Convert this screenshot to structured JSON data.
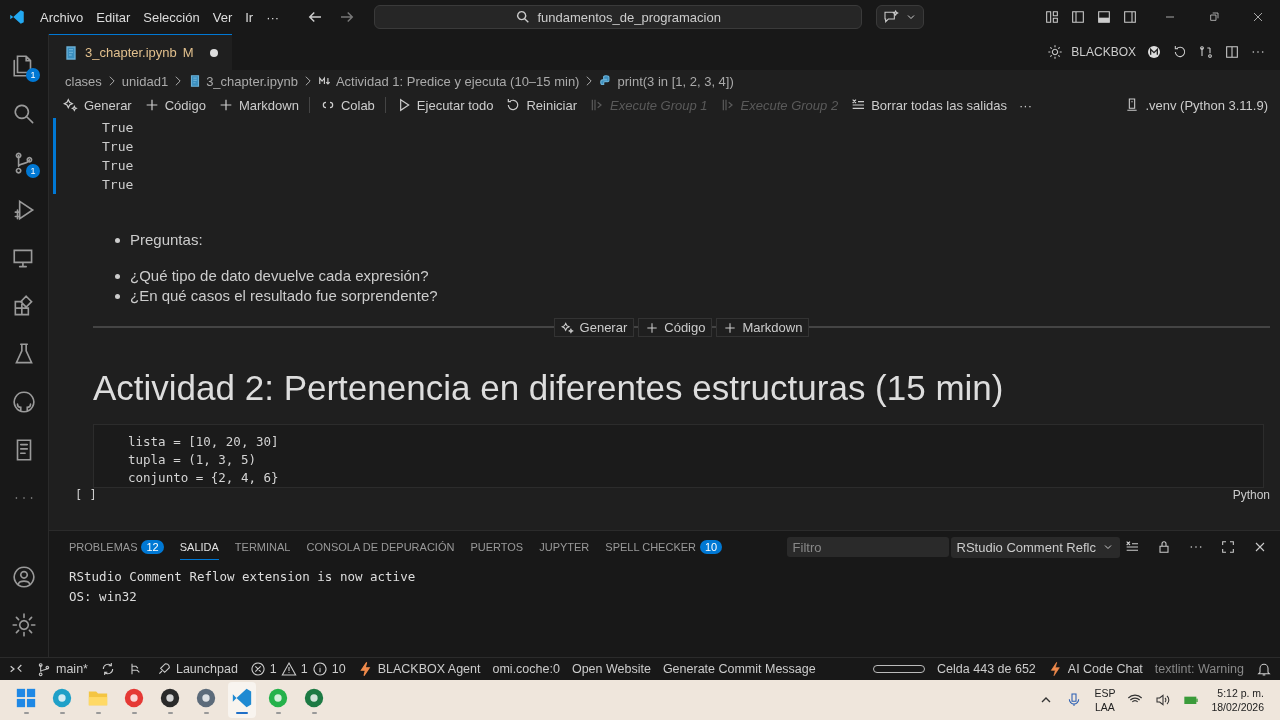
{
  "title_bar": {
    "menu": [
      "Archivo",
      "Editar",
      "Selección",
      "Ver",
      "Ir",
      "···"
    ],
    "search": "fundamentos_de_programacion"
  },
  "activity_bar": [
    {
      "kind": "files",
      "badge": "1"
    },
    {
      "kind": "search"
    },
    {
      "kind": "branch",
      "badge": "1"
    },
    {
      "kind": "debug"
    },
    {
      "kind": "remote"
    },
    {
      "kind": "extensions"
    },
    {
      "kind": "flask"
    },
    {
      "kind": "github"
    },
    {
      "kind": "notebook"
    },
    {
      "kind": "more"
    }
  ],
  "activity_bottom": [
    {
      "kind": "account"
    },
    {
      "kind": "settings"
    }
  ],
  "tabs": [
    {
      "label": "3_chapter.ipynb",
      "status": "M",
      "modified": true,
      "selected": true
    }
  ],
  "editor_actions": {
    "label": "BLACKBOX"
  },
  "breadcrumb": [
    {
      "kind": "folder",
      "label": "clases"
    },
    {
      "kind": "folder",
      "label": "unidad1"
    },
    {
      "kind": "notebook",
      "label": "3_chapter.ipynb"
    },
    {
      "kind": "markdown",
      "label": "Actividad 1: Predice y ejecuta (10–15 min)"
    },
    {
      "kind": "python",
      "label": "print(3 in [1, 2, 3, 4])"
    }
  ],
  "toolbar": [
    {
      "kind": "sparkle",
      "label": "Generar",
      "disabled": false
    },
    {
      "kind": "plus",
      "label": "Código",
      "disabled": false
    },
    {
      "kind": "plus",
      "label": "Markdown",
      "disabled": false
    },
    {
      "kind": "colab",
      "label": "Colab",
      "disabled": false
    },
    {
      "kind": "run",
      "label": "Ejecutar todo",
      "disabled": false
    },
    {
      "kind": "restart",
      "label": "Reiniciar",
      "disabled": false
    },
    {
      "kind": "group",
      "label": "Execute Group 1",
      "disabled": true
    },
    {
      "kind": "group",
      "label": "Execute Group 2",
      "disabled": true
    },
    {
      "kind": "clear",
      "label": "Borrar todas las salidas",
      "disabled": false
    },
    {
      "kind": "more",
      "label": "···",
      "disabled": false
    }
  ],
  "kernel": ".venv (Python 3.11.9)",
  "output_lines": [
    "True",
    "True",
    "True",
    "True"
  ],
  "markdown": {
    "lead": "Preguntas:",
    "questions": [
      "¿Qué tipo de dato devuelve cada expresión?",
      "¿En qué casos el resultado fue sorprendente?"
    ]
  },
  "insert_bar": [
    {
      "kind": "sparkle",
      "label": "Generar"
    },
    {
      "kind": "plus",
      "label": "Código"
    },
    {
      "kind": "plus",
      "label": "Markdown"
    }
  ],
  "heading": "Actividad 2: Pertenencia en diferentes estructuras (15 min)",
  "code_cell": {
    "exec": "[ ]",
    "language": "Python",
    "lines": [
      "lista = [10, 20, 30]",
      "tupla = (1, 3, 5)",
      "conjunto = {2, 4, 6}"
    ]
  },
  "panel": {
    "tabs": [
      {
        "label": "PROBLEMAS",
        "badge": "12",
        "selected": false
      },
      {
        "label": "SALIDA",
        "selected": true
      },
      {
        "label": "TERMINAL",
        "selected": false
      },
      {
        "label": "CONSOLA DE DEPURACIÓN",
        "selected": false
      },
      {
        "label": "PUERTOS",
        "selected": false
      },
      {
        "label": "JUPYTER",
        "selected": false
      },
      {
        "label": "SPELL CHECKER",
        "badge": "10",
        "selected": false
      }
    ],
    "filter_placeholder": "Filtro",
    "channel": "RStudio Comment Reflc",
    "output": [
      "RStudio Comment Reflow extension is now active",
      "OS: win32"
    ]
  },
  "status_bar": {
    "left": [
      {
        "kind": "branch",
        "label": "main*"
      },
      {
        "kind": "graph"
      },
      {
        "kind": "launchpad",
        "label": "Launchpad"
      },
      {
        "kind": "problems",
        "errors": "1",
        "warnings": "1",
        "infos": "10"
      },
      {
        "kind": "bolt",
        "label": "BLACKBOX Agent"
      },
      {
        "kind": "text",
        "label": "omi.coche:0"
      },
      {
        "kind": "text",
        "label": "Open Website"
      },
      {
        "kind": "text",
        "label": "Generate Commit Message"
      }
    ],
    "right": [
      {
        "kind": "progress"
      },
      {
        "kind": "text",
        "label": "Celda 443 de 652"
      },
      {
        "kind": "bolt",
        "label": "AI Code Chat"
      },
      {
        "kind": "dim",
        "label": "textlint: Warning"
      },
      {
        "kind": "bell"
      }
    ]
  },
  "taskbar": {
    "apps": [
      {
        "kind": "start",
        "selected": false
      },
      {
        "kind": "edge",
        "selected": false
      },
      {
        "kind": "folder",
        "selected": false
      },
      {
        "kind": "chrome",
        "selected": false
      },
      {
        "kind": "obs",
        "selected": false
      },
      {
        "kind": "settings",
        "selected": false
      },
      {
        "kind": "vscode",
        "selected": true
      },
      {
        "kind": "whatsapp",
        "selected": false
      },
      {
        "kind": "excel",
        "selected": false
      }
    ],
    "language": [
      "ESP",
      "LAA"
    ],
    "time": "5:12 p. m.",
    "date": "18/02/2026"
  }
}
